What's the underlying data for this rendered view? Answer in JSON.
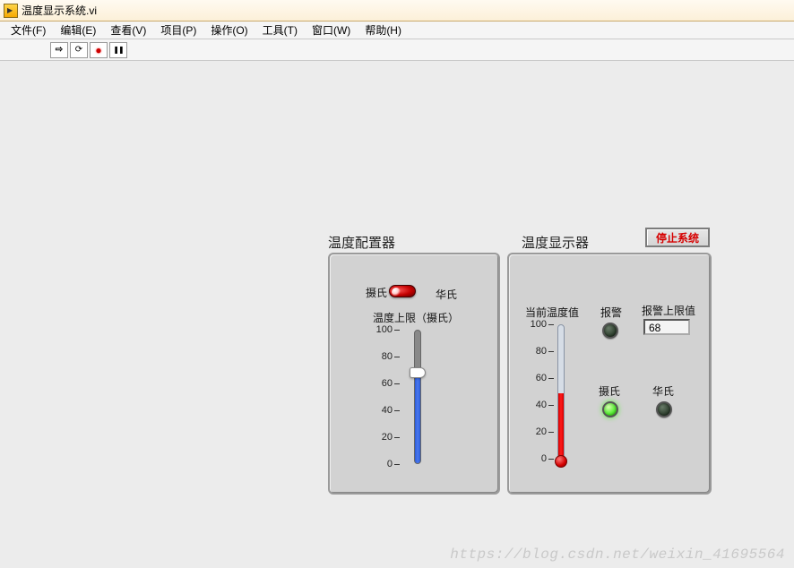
{
  "window": {
    "title": "温度显示系统.vi"
  },
  "menu": {
    "file": "文件(F)",
    "edit": "编辑(E)",
    "view": "查看(V)",
    "project": "项目(P)",
    "operate": "操作(O)",
    "tools": "工具(T)",
    "window": "窗口(W)",
    "help": "帮助(H)"
  },
  "panels": {
    "config": {
      "title": "温度配置器",
      "unit_celsius": "摄氏",
      "unit_fahrenheit": "华氏",
      "limit_label": "温度上限（摄氏）",
      "ticks": [
        "100",
        "80",
        "60",
        "40",
        "20",
        "0"
      ],
      "limit_value": 68,
      "scale_max": 100
    },
    "display": {
      "title": "温度显示器",
      "current_label": "当前温度值",
      "alarm_label": "报警",
      "alarm_limit_label": "报警上限值",
      "alarm_limit_value": "68",
      "celsius_label": "摄氏",
      "fahrenheit_label": "华氏",
      "ticks": [
        "100",
        "80",
        "60",
        "40",
        "20",
        "0"
      ],
      "temp_value": 48,
      "scale_max": 100,
      "alarm_on": false,
      "celsius_on": true,
      "fahrenheit_on": false
    },
    "stop_label": "停止系统"
  },
  "watermark": "https://blog.csdn.net/weixin_41695564"
}
